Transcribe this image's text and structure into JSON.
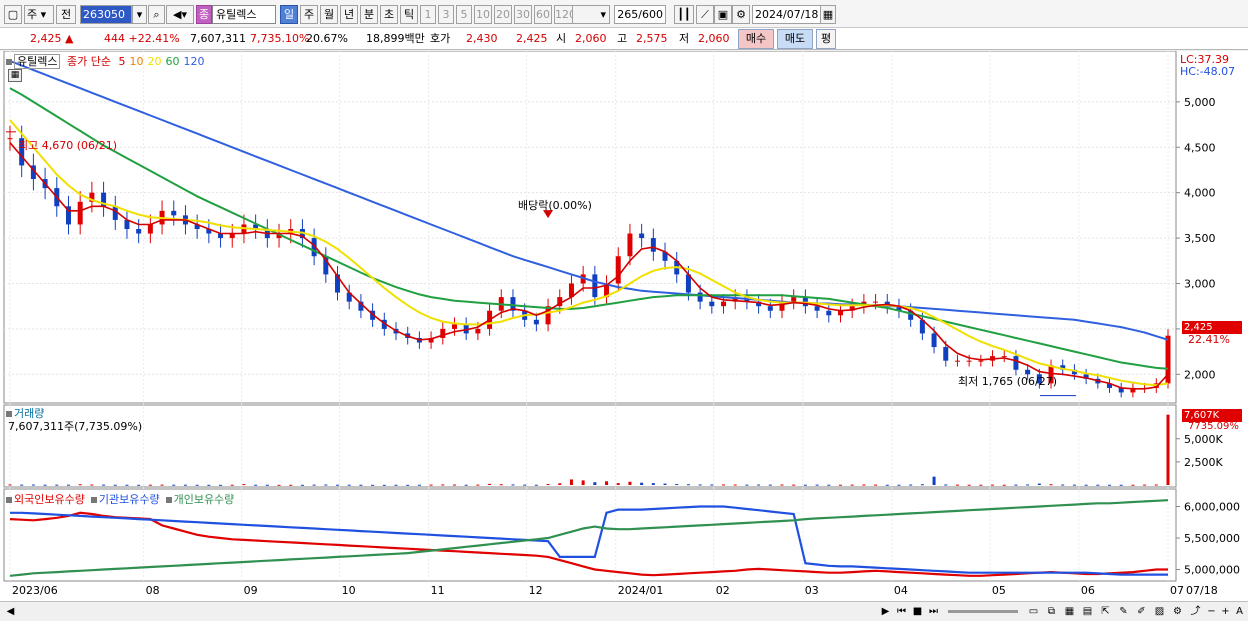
{
  "toolbar": {
    "period": "주",
    "prev_label": "전",
    "stock_code": "263050",
    "stock_badge": "종",
    "stock_name": "유틸렉스",
    "periods": [
      "일",
      "주",
      "월",
      "년",
      "분",
      "초",
      "틱"
    ],
    "active_period": "일",
    "intervals": [
      "1",
      "3",
      "5",
      "10",
      "20",
      "30",
      "60",
      "120"
    ],
    "count": "265",
    "count_max": "/600",
    "date": "2024/07/18"
  },
  "quote": {
    "price": "2,425",
    "change_arrow": "▲",
    "change": "444",
    "change_pct": "+22.41%",
    "volume": "7,607,311",
    "volume_pct": "7,735.10%",
    "turnover": "20.67%",
    "amount": "18,899백만",
    "bid_label": "호가",
    "bid": "2,430",
    "ask": "2,425",
    "open_label": "시",
    "open": "2,060",
    "high_label": "고",
    "high": "2,575",
    "low_label": "저",
    "low": "2,060",
    "buy_label": "매수",
    "sell_label": "매도",
    "eval_label": "평"
  },
  "price_pane": {
    "stock_label": "유틸렉스",
    "ma_label": "종가 단순",
    "ma_periods": [
      "5",
      "10",
      "20",
      "60",
      "120"
    ],
    "ma_colors": [
      "#d40000",
      "#f08000",
      "#f0e000",
      "#20a040",
      "#3060e0"
    ],
    "lc": "LC:37.39",
    "hc": "HC:-48.07",
    "price_ticks": [
      "5,000",
      "4,500",
      "4,000",
      "3,500",
      "3,000",
      "2,500",
      "2,000"
    ],
    "current_price_tag": "2,425",
    "current_pct": "22.41%",
    "high_annot": "최고 4,670 (06/21)",
    "low_annot": "최저 1,765 (06/27)",
    "dividend_annot": "배당락(0.00%)"
  },
  "volume_pane": {
    "title": "거래량",
    "value": "7,607,311주(7,735.09%)",
    "tag": "7,607K",
    "tag_pct": "7735.09%",
    "ticks": [
      "5,000K",
      "2,500K"
    ]
  },
  "holdings_pane": {
    "series": [
      "외국인보유수량",
      "기관보유수량",
      "개인보유수량"
    ],
    "colors": [
      "#e00000",
      "#2050e0",
      "#309050"
    ],
    "ticks": [
      "6,000,000",
      "5,500,000",
      "5,000,000"
    ]
  },
  "x_axis": {
    "labels": [
      "2023/06",
      "08",
      "09",
      "10",
      "11",
      "12",
      "2024/01",
      "02",
      "03",
      "04",
      "05",
      "06",
      "07"
    ],
    "last_date": "07/18"
  },
  "chart_data": {
    "type": "line",
    "price_range": [
      1750,
      5450
    ],
    "close": [
      4600,
      4300,
      4150,
      4050,
      3850,
      3650,
      3900,
      4000,
      3850,
      3700,
      3600,
      3550,
      3650,
      3800,
      3750,
      3650,
      3600,
      3550,
      3500,
      3550,
      3650,
      3600,
      3500,
      3550,
      3600,
      3500,
      3300,
      3100,
      2900,
      2800,
      2700,
      2600,
      2500,
      2450,
      2400,
      2350,
      2400,
      2500,
      2550,
      2450,
      2500,
      2700,
      2850,
      2700,
      2600,
      2550,
      2750,
      2850,
      3000,
      3100,
      2850,
      3000,
      3300,
      3550,
      3500,
      3350,
      3250,
      3100,
      2900,
      2800,
      2750,
      2800,
      2850,
      2800,
      2750,
      2700,
      2800,
      2850,
      2750,
      2700,
      2650,
      2700,
      2750,
      2800,
      2800,
      2750,
      2700,
      2600,
      2450,
      2300,
      2150,
      2150,
      2150,
      2150,
      2200,
      2200,
      2050,
      2000,
      1900,
      2100,
      2050,
      2000,
      1950,
      1900,
      1850,
      1800,
      1850,
      1850,
      1900,
      2425
    ],
    "ma5": [
      4550,
      4400,
      4250,
      4100,
      3950,
      3800,
      3800,
      3850,
      3850,
      3800,
      3700,
      3650,
      3650,
      3700,
      3700,
      3700,
      3650,
      3600,
      3550,
      3550,
      3550,
      3570,
      3550,
      3550,
      3550,
      3520,
      3420,
      3260,
      3080,
      2900,
      2780,
      2660,
      2560,
      2480,
      2420,
      2380,
      2390,
      2430,
      2470,
      2490,
      2520,
      2600,
      2680,
      2720,
      2700,
      2650,
      2700,
      2780,
      2850,
      2950,
      2950,
      2980,
      3080,
      3250,
      3380,
      3400,
      3350,
      3250,
      3100,
      2950,
      2850,
      2820,
      2810,
      2800,
      2790,
      2760,
      2770,
      2790,
      2780,
      2760,
      2720,
      2700,
      2710,
      2740,
      2760,
      2770,
      2750,
      2700,
      2600,
      2480,
      2330,
      2230,
      2180,
      2160,
      2170,
      2180,
      2150,
      2100,
      2030,
      2010,
      2000,
      1980,
      1960,
      1930,
      1900,
      1850,
      1840,
      1840,
      1860,
      2000
    ],
    "ma20": [
      4800,
      4650,
      4500,
      4350,
      4200,
      4080,
      3980,
      3920,
      3880,
      3850,
      3800,
      3760,
      3730,
      3720,
      3710,
      3700,
      3690,
      3670,
      3640,
      3620,
      3610,
      3600,
      3590,
      3580,
      3570,
      3560,
      3520,
      3460,
      3380,
      3280,
      3170,
      3060,
      2950,
      2850,
      2760,
      2680,
      2620,
      2580,
      2560,
      2550,
      2550,
      2560,
      2580,
      2620,
      2650,
      2660,
      2680,
      2700,
      2740,
      2790,
      2820,
      2860,
      2920,
      3000,
      3080,
      3140,
      3170,
      3180,
      3160,
      3110,
      3040,
      2970,
      2900,
      2850,
      2820,
      2800,
      2790,
      2790,
      2790,
      2780,
      2770,
      2760,
      2760,
      2760,
      2760,
      2760,
      2750,
      2730,
      2690,
      2630,
      2560,
      2490,
      2420,
      2360,
      2310,
      2270,
      2220,
      2170,
      2120,
      2090,
      2060,
      2040,
      2010,
      1990,
      1960,
      1930,
      1910,
      1890,
      1880,
      1900
    ],
    "ma60": [
      5150,
      5080,
      5000,
      4920,
      4840,
      4760,
      4680,
      4600,
      4520,
      4450,
      4380,
      4310,
      4240,
      4170,
      4100,
      4030,
      3960,
      3900,
      3840,
      3780,
      3720,
      3660,
      3600,
      3540,
      3480,
      3420,
      3360,
      3300,
      3240,
      3180,
      3120,
      3060,
      3010,
      2960,
      2920,
      2880,
      2850,
      2830,
      2810,
      2800,
      2790,
      2780,
      2770,
      2760,
      2750,
      2740,
      2730,
      2720,
      2720,
      2730,
      2750,
      2770,
      2790,
      2810,
      2830,
      2850,
      2860,
      2870,
      2870,
      2870,
      2870,
      2870,
      2870,
      2870,
      2870,
      2870,
      2870,
      2860,
      2850,
      2840,
      2830,
      2810,
      2790,
      2770,
      2750,
      2730,
      2700,
      2670,
      2640,
      2610,
      2580,
      2550,
      2520,
      2490,
      2460,
      2430,
      2400,
      2370,
      2340,
      2310,
      2280,
      2250,
      2220,
      2190,
      2160,
      2130,
      2110,
      2090,
      2070,
      2060
    ],
    "ma120": [
      5450,
      5400,
      5350,
      5300,
      5250,
      5200,
      5150,
      5100,
      5050,
      5000,
      4950,
      4900,
      4850,
      4800,
      4750,
      4700,
      4650,
      4600,
      4550,
      4500,
      4450,
      4400,
      4350,
      4300,
      4250,
      4200,
      4150,
      4100,
      4050,
      4000,
      3950,
      3900,
      3850,
      3800,
      3750,
      3700,
      3650,
      3600,
      3550,
      3500,
      3450,
      3400,
      3350,
      3300,
      3260,
      3220,
      3180,
      3140,
      3100,
      3060,
      3020,
      2990,
      2960,
      2940,
      2920,
      2910,
      2900,
      2890,
      2880,
      2870,
      2860,
      2850,
      2840,
      2830,
      2820,
      2810,
      2800,
      2790,
      2790,
      2780,
      2780,
      2770,
      2770,
      2760,
      2760,
      2750,
      2750,
      2740,
      2730,
      2720,
      2710,
      2700,
      2690,
      2680,
      2670,
      2660,
      2650,
      2640,
      2630,
      2620,
      2610,
      2600,
      2580,
      2560,
      2540,
      2520,
      2490,
      2460,
      2420,
      2380
    ],
    "volume_k": [
      60,
      40,
      50,
      30,
      40,
      35,
      80,
      50,
      40,
      30,
      30,
      25,
      30,
      40,
      30,
      30,
      25,
      20,
      20,
      30,
      100,
      30,
      25,
      20,
      25,
      20,
      40,
      50,
      30,
      30,
      25,
      20,
      20,
      25,
      20,
      30,
      40,
      60,
      50,
      30,
      40,
      120,
      80,
      60,
      40,
      30,
      100,
      180,
      600,
      500,
      300,
      400,
      200,
      350,
      250,
      200,
      150,
      100,
      80,
      60,
      50,
      60,
      50,
      40,
      50,
      40,
      50,
      40,
      30,
      40,
      30,
      30,
      40,
      50,
      40,
      30,
      30,
      50,
      80,
      900,
      50,
      40,
      30,
      30,
      40,
      30,
      40,
      60,
      150,
      80,
      50,
      40,
      30,
      30,
      25,
      25,
      30,
      40,
      50,
      7607
    ],
    "foreign_holdings": [
      5800000,
      5790000,
      5780000,
      5800000,
      5820000,
      5850000,
      5900000,
      5880000,
      5850000,
      5830000,
      5820000,
      5810000,
      5800000,
      5700000,
      5650000,
      5600000,
      5550000,
      5520000,
      5500000,
      5480000,
      5470000,
      5460000,
      5450000,
      5440000,
      5430000,
      5420000,
      5410000,
      5400000,
      5390000,
      5380000,
      5370000,
      5360000,
      5350000,
      5340000,
      5330000,
      5320000,
      5310000,
      5300000,
      5290000,
      5280000,
      5270000,
      5260000,
      5250000,
      5240000,
      5230000,
      5220000,
      5200000,
      5150000,
      5100000,
      5050000,
      5000000,
      4980000,
      4960000,
      4940000,
      4920000,
      4910000,
      4920000,
      4930000,
      4940000,
      4950000,
      4960000,
      4970000,
      4980000,
      5000000,
      5010000,
      5000000,
      4990000,
      4980000,
      4970000,
      4960000,
      4950000,
      4950000,
      4960000,
      4970000,
      4980000,
      4970000,
      4960000,
      4950000,
      4940000,
      4930000,
      4920000,
      4910000,
      4900000,
      4900000,
      4910000,
      4920000,
      4930000,
      4940000,
      4950000,
      4960000,
      4950000,
      4940000,
      4930000,
      4930000,
      4940000,
      4950000,
      4960000,
      4980000,
      5000000,
      5000000
    ],
    "inst_holdings": [
      5900000,
      5900000,
      5890000,
      5880000,
      5870000,
      5860000,
      5850000,
      5840000,
      5830000,
      5820000,
      5810000,
      5800000,
      5790000,
      5780000,
      5770000,
      5760000,
      5750000,
      5740000,
      5730000,
      5720000,
      5710000,
      5700000,
      5690000,
      5680000,
      5670000,
      5660000,
      5650000,
      5640000,
      5630000,
      5620000,
      5610000,
      5600000,
      5590000,
      5580000,
      5570000,
      5560000,
      5550000,
      5540000,
      5530000,
      5520000,
      5510000,
      5500000,
      5490000,
      5480000,
      5470000,
      5460000,
      5450000,
      5200000,
      5200000,
      5200000,
      5200000,
      5900000,
      5950000,
      5950000,
      5950000,
      5960000,
      5970000,
      5980000,
      5990000,
      6000000,
      6000000,
      6000000,
      5980000,
      5960000,
      5940000,
      5920000,
      5900000,
      5880000,
      5100000,
      5080000,
      5060000,
      5050000,
      5050000,
      5040000,
      5030000,
      5020000,
      5010000,
      5000000,
      4990000,
      4980000,
      4970000,
      4960000,
      4950000,
      4950000,
      4950000,
      4950000,
      4950000,
      4950000,
      4950000,
      4950000,
      4950000,
      4950000,
      4950000,
      4940000,
      4930000,
      4920000,
      4920000,
      4920000,
      4920000,
      4920000
    ],
    "retail_holdings": [
      4900000,
      4920000,
      4940000,
      4950000,
      4960000,
      4970000,
      4980000,
      4990000,
      5000000,
      5010000,
      5020000,
      5030000,
      5040000,
      5050000,
      5060000,
      5070000,
      5080000,
      5090000,
      5100000,
      5110000,
      5120000,
      5130000,
      5140000,
      5150000,
      5160000,
      5170000,
      5180000,
      5190000,
      5200000,
      5210000,
      5220000,
      5230000,
      5240000,
      5250000,
      5260000,
      5280000,
      5300000,
      5320000,
      5340000,
      5360000,
      5380000,
      5400000,
      5420000,
      5440000,
      5460000,
      5480000,
      5500000,
      5550000,
      5600000,
      5650000,
      5680000,
      5650000,
      5640000,
      5640000,
      5650000,
      5660000,
      5670000,
      5680000,
      5690000,
      5700000,
      5710000,
      5720000,
      5730000,
      5740000,
      5750000,
      5760000,
      5770000,
      5780000,
      5800000,
      5810000,
      5820000,
      5830000,
      5840000,
      5850000,
      5860000,
      5870000,
      5880000,
      5890000,
      5900000,
      5910000,
      5920000,
      5930000,
      5940000,
      5950000,
      5960000,
      5970000,
      5980000,
      5990000,
      6000000,
      6010000,
      6020000,
      6030000,
      6040000,
      6050000,
      6050000,
      6060000,
      6070000,
      6080000,
      6090000,
      6100000
    ]
  }
}
